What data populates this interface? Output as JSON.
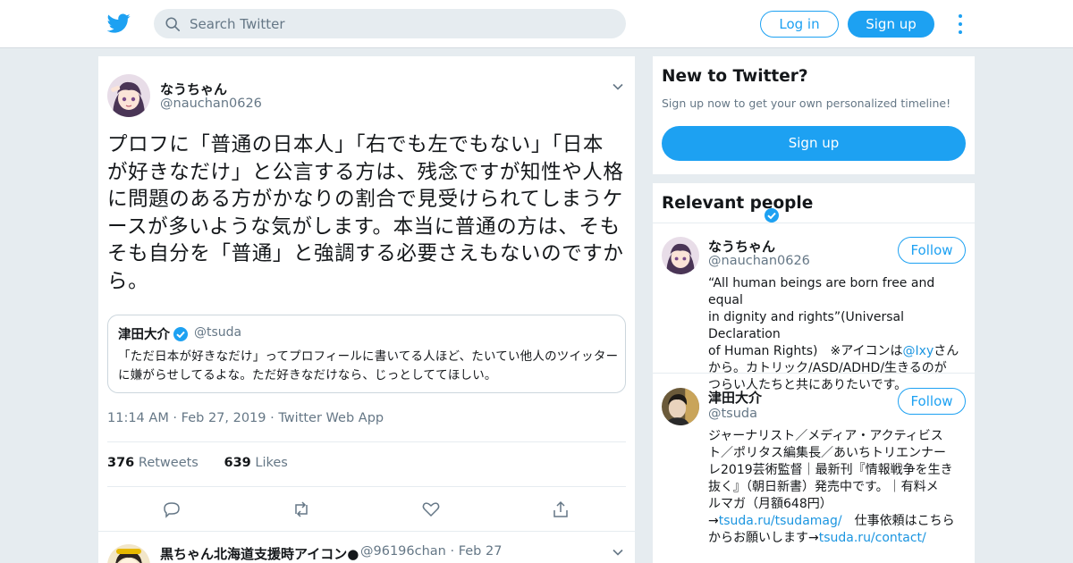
{
  "topbar": {
    "logo_icon": "twitter-bird-icon",
    "search_placeholder": "Search Twitter",
    "login_label": "Log in",
    "signup_label": "Sign up",
    "more_icon": "more-vertical-icon"
  },
  "tweet": {
    "name": "なうちゃん",
    "handle": "@nauchan0626",
    "text": "プロフに「普通の日本人」「右でも左でもない」「日本が好きなだけ」と公言する方は、残念ですが知性や人格に問題のある方がかなりの割合で見受けられてしまうケースが多いような気がします。本当に普通の方は、そもそも自分を「普通」と強調する必要さえもないのですから。",
    "quote": {
      "name": "津田大介",
      "handle": "@tsuda",
      "text": "「ただ日本が好きなだけ」ってプロフィールに書いてる人ほど、たいてい他人のツイッターに嫌がらせしてるよな。ただ好きなだけなら、じっとしててほしい。"
    },
    "time": "11:14 AM",
    "date": "Feb 27, 2019",
    "source": "Twitter Web App",
    "retweets_count": "376",
    "retweets_label": "Retweets",
    "likes_count": "639",
    "likes_label": "Likes"
  },
  "reply": {
    "name": "黒ちゃん北海道支援時アイコン●",
    "handle": "@96196chan",
    "date": "Feb 27"
  },
  "signup_panel": {
    "title": "New to Twitter?",
    "subtitle": "Sign up now to get your own personalized timeline!",
    "button": "Sign up"
  },
  "relevant": {
    "title": "Relevant people",
    "people": [
      {
        "name": "なうちゃん",
        "handle": "@nauchan0626",
        "follow": "Follow",
        "bio_lines": [
          "“All human beings are born free and equal",
          "in dignity and rights”(Universal Declaration",
          "of Human Rights)　※アイコンは",
          "から。カトリック/ASD/ADHD/生きるのが",
          "つらい人たちと共にありたいです。"
        ],
        "bio_link": "@Ixy",
        "bio_link_after": "さん"
      },
      {
        "name": "津田大介",
        "handle": "@tsuda",
        "follow": "Follow",
        "bio_lines": [
          "ジャーナリスト／メディア・アクティビス",
          "ト／ポリタス編集長／あいちトリエンナー",
          "レ2019芸術監督｜最新刊『情報戦争を生き",
          "抜く』（朝日新書）発売中です。｜有料メ",
          "ルマガ（月額648円）"
        ],
        "link1_prefix": "→",
        "link1": "tsuda.ru/tsudamag/",
        "link1_after": "　仕事依頼はこちら",
        "line_last_prefix": "からお願いします→",
        "link2": "tsuda.ru/contact/"
      }
    ]
  },
  "colors": {
    "accent": "#1da1f2",
    "background": "#e6ecf0",
    "muted_text": "#657786"
  }
}
